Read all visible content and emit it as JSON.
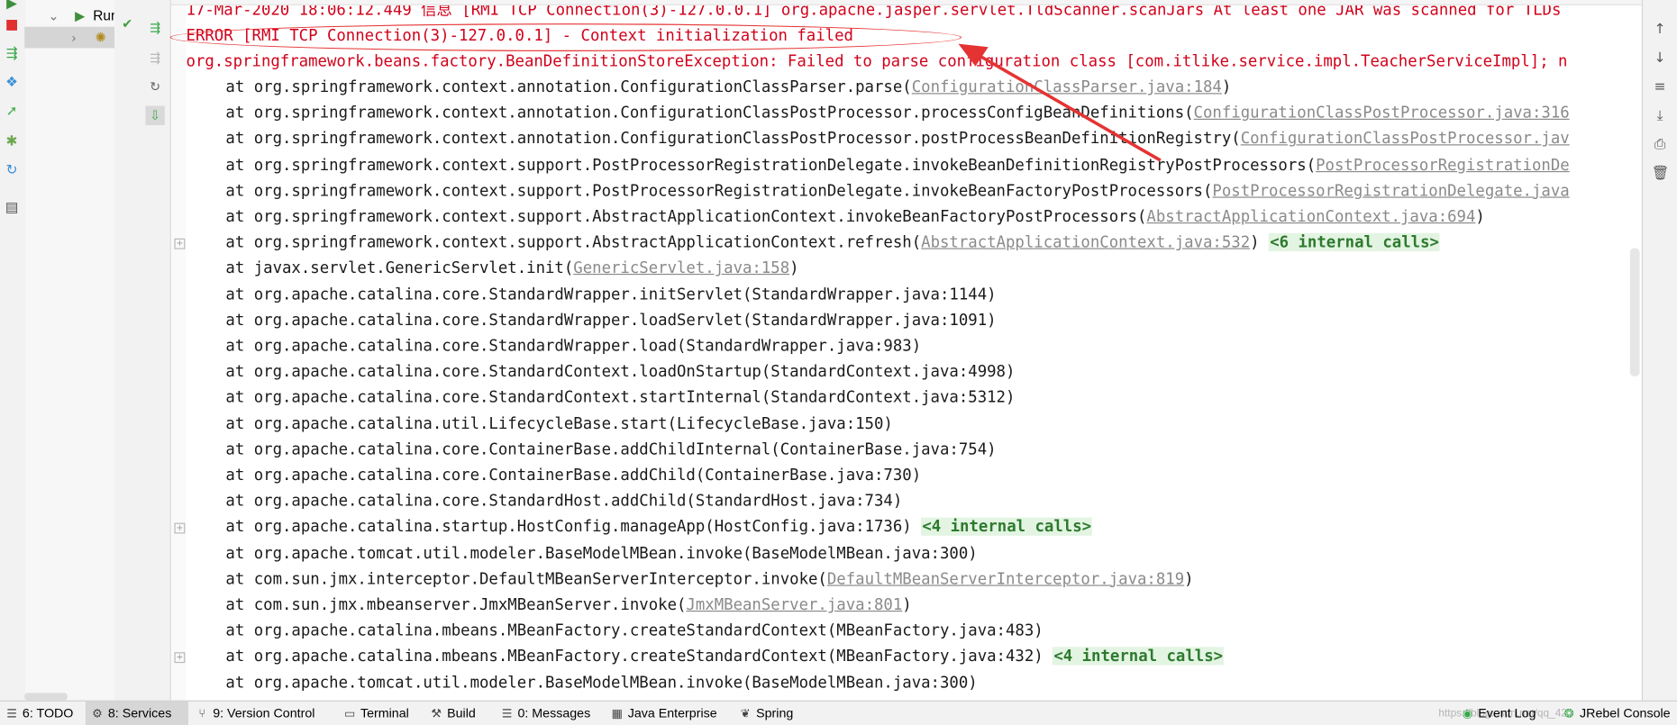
{
  "tree": {
    "run_label": "Run"
  },
  "console": {
    "top_partial": "17-Mar-2020 18:06:12.449 信息 [RMI TCP Connection(3)-127.0.0.1] org.apache.jasper.servlet.TldScanner.scanJars At least one JAR was scanned for TLDs",
    "error_line": "ERROR [RMI TCP Connection(3)-127.0.0.1] - Context initialization failed",
    "exception_line": "org.springframework.beans.factory.BeanDefinitionStoreException: Failed to parse configuration class [com.itlike.service.impl.TeacherServiceImpl]; n",
    "frames": [
      {
        "text": "at org.springframework.context.annotation.ConfigurationClassParser.parse(",
        "link": "ConfigurationClassParser.java:184",
        "tail": ")"
      },
      {
        "text": "at org.springframework.context.annotation.ConfigurationClassPostProcessor.processConfigBeanDefinitions(",
        "link": "ConfigurationClassPostProcessor.java:316",
        "tail": ""
      },
      {
        "text": "at org.springframework.context.annotation.ConfigurationClassPostProcessor.postProcessBeanDefinitionRegistry(",
        "link": "ConfigurationClassPostProcessor.jav",
        "tail": ""
      },
      {
        "text": "at org.springframework.context.support.PostProcessorRegistrationDelegate.invokeBeanDefinitionRegistryPostProcessors(",
        "link": "PostProcessorRegistrationDe",
        "tail": ""
      },
      {
        "text": "at org.springframework.context.support.PostProcessorRegistrationDelegate.invokeBeanFactoryPostProcessors(",
        "link": "PostProcessorRegistrationDelegate.java",
        "tail": ""
      },
      {
        "text": "at org.springframework.context.support.AbstractApplicationContext.invokeBeanFactoryPostProcessors(",
        "link": "AbstractApplicationContext.java:694",
        "tail": ")"
      },
      {
        "text": "at org.springframework.context.support.AbstractApplicationContext.refresh(",
        "link": "AbstractApplicationContext.java:532",
        "tail": ")",
        "internal": "<6 internal calls>",
        "fold": true
      },
      {
        "text": "at javax.servlet.GenericServlet.init(",
        "link": "GenericServlet.java:158",
        "tail": ")"
      },
      {
        "text": "at org.apache.catalina.core.StandardWrapper.initServlet(StandardWrapper.java:1144)"
      },
      {
        "text": "at org.apache.catalina.core.StandardWrapper.loadServlet(StandardWrapper.java:1091)"
      },
      {
        "text": "at org.apache.catalina.core.StandardWrapper.load(StandardWrapper.java:983)"
      },
      {
        "text": "at org.apache.catalina.core.StandardContext.loadOnStartup(StandardContext.java:4998)"
      },
      {
        "text": "at org.apache.catalina.core.StandardContext.startInternal(StandardContext.java:5312)"
      },
      {
        "text": "at org.apache.catalina.util.LifecycleBase.start(LifecycleBase.java:150)"
      },
      {
        "text": "at org.apache.catalina.core.ContainerBase.addChildInternal(ContainerBase.java:754)"
      },
      {
        "text": "at org.apache.catalina.core.ContainerBase.addChild(ContainerBase.java:730)"
      },
      {
        "text": "at org.apache.catalina.core.StandardHost.addChild(StandardHost.java:734)"
      },
      {
        "text": "at org.apache.catalina.startup.HostConfig.manageApp(HostConfig.java:1736)",
        "internal": "<4 internal calls>",
        "fold": true
      },
      {
        "text": "at org.apache.tomcat.util.modeler.BaseModelMBean.invoke(BaseModelMBean.java:300)"
      },
      {
        "text": "at com.sun.jmx.interceptor.DefaultMBeanServerInterceptor.invoke(",
        "link": "DefaultMBeanServerInterceptor.java:819",
        "tail": ")"
      },
      {
        "text": "at com.sun.jmx.mbeanserver.JmxMBeanServer.invoke(",
        "link": "JmxMBeanServer.java:801",
        "tail": ")"
      },
      {
        "text": "at org.apache.catalina.mbeans.MBeanFactory.createStandardContext(MBeanFactory.java:483)"
      },
      {
        "text": "at org.apache.catalina.mbeans.MBeanFactory.createStandardContext(MBeanFactory.java:432)",
        "internal": "<4 internal calls>",
        "fold": true
      },
      {
        "text": "at org.apache.tomcat.util.modeler.BaseModelMBean.invoke(BaseModelMBean.java:300)"
      }
    ]
  },
  "bottom_tabs": [
    {
      "label": "6: TODO",
      "icon": "list-icon"
    },
    {
      "label": "8: Services",
      "icon": "services-icon",
      "active": true
    },
    {
      "label": "9: Version Control",
      "icon": "branch-icon"
    },
    {
      "label": "Terminal",
      "icon": "terminal-icon"
    },
    {
      "label": "Build",
      "icon": "hammer-icon"
    },
    {
      "label": "0: Messages",
      "icon": "messages-icon"
    },
    {
      "label": "Java Enterprise",
      "icon": "java-enterprise-icon"
    },
    {
      "label": "Spring",
      "icon": "spring-icon"
    }
  ],
  "right_tabs": [
    {
      "label": "Event Log",
      "icon": "event-log-icon"
    },
    {
      "label": "JRebel Console",
      "icon": "jrebel-icon"
    }
  ],
  "watermark": "https://blog.csdn.net/qq_42..",
  "colors": {
    "error": "#d0021b",
    "link": "#8a8a8a",
    "internal_bg": "#e3f4e3",
    "internal_fg": "#2d7a2d",
    "annotation": "#e53333"
  }
}
